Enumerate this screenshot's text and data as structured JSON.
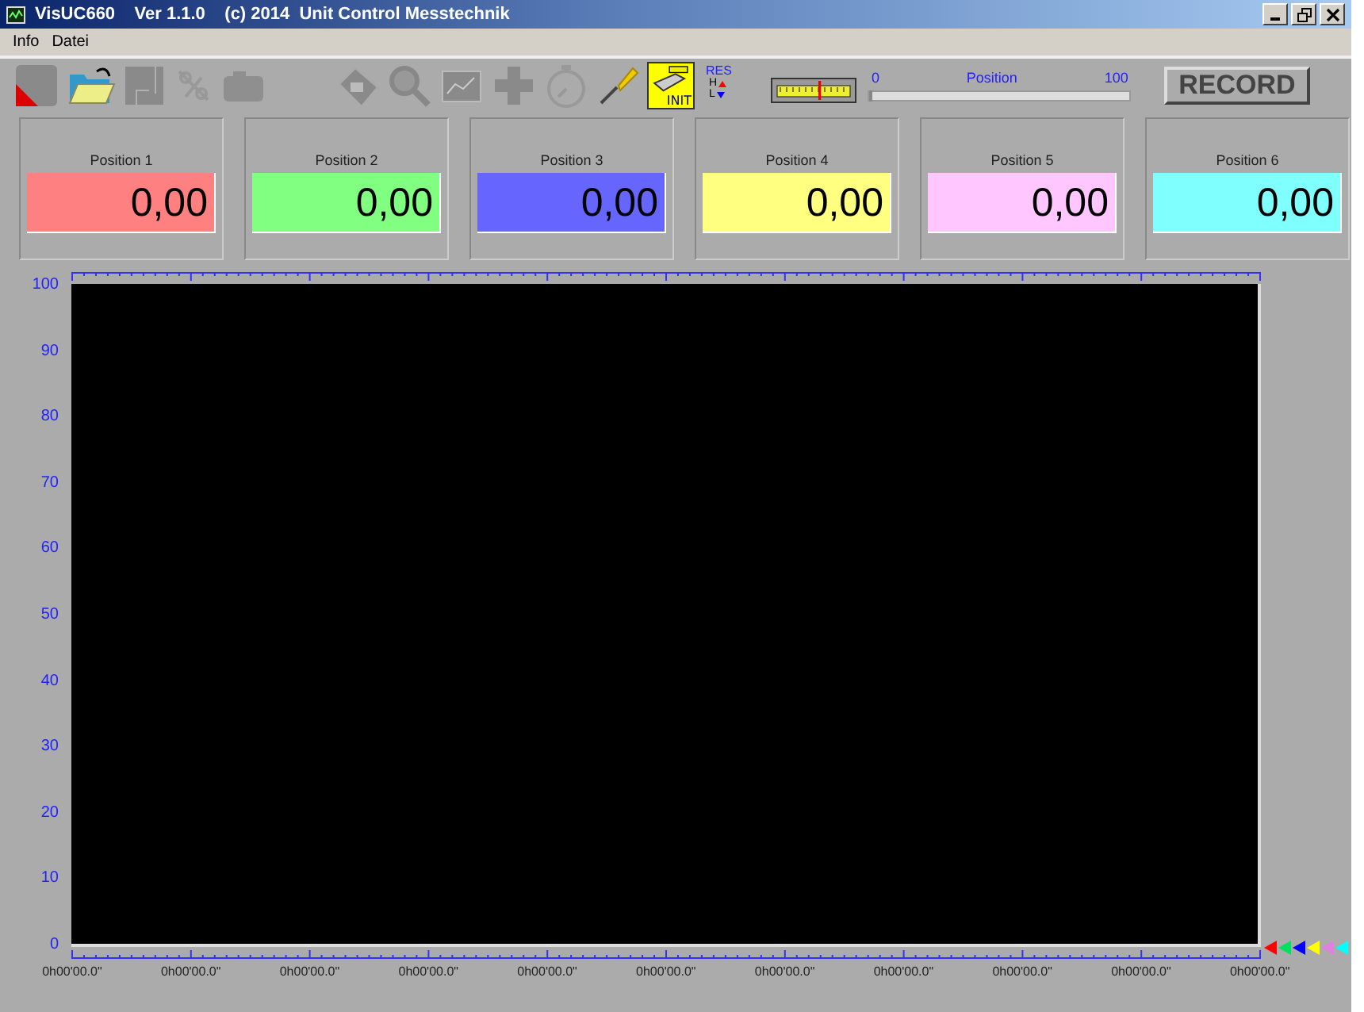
{
  "window": {
    "title": "VisUC660    Ver 1.1.0    (c) 2014  Unit Control Messtechnik"
  },
  "menu": [
    "Info",
    "Datei"
  ],
  "toolbar": {
    "init_label": "INIT",
    "res_label": "RES",
    "high_label": "H",
    "low_label": "L"
  },
  "position_slider": {
    "min_label": "0",
    "label": "Position",
    "max_label": "100",
    "level": 0
  },
  "record_button": "RECORD",
  "positions": [
    {
      "label": "Position 1",
      "value": "0,00",
      "color": "#ff8080"
    },
    {
      "label": "Position 2",
      "value": "0,00",
      "color": "#80ff80"
    },
    {
      "label": "Position 3",
      "value": "0,00",
      "color": "#6666ff"
    },
    {
      "label": "Position 4",
      "value": "0,00",
      "color": "#ffff80"
    },
    {
      "label": "Position 5",
      "value": "0,00",
      "color": "#ffc6ff"
    },
    {
      "label": "Position 6",
      "value": "0,00",
      "color": "#80ffff"
    }
  ],
  "plot": {
    "y_labels": [
      "100",
      "90",
      "80",
      "70",
      "60",
      "50",
      "40",
      "30",
      "20",
      "10",
      "0"
    ],
    "x_labels": [
      "0h00'00.0\"",
      "0h00'00.0\"",
      "0h00'00.0\"",
      "0h00'00.0\"",
      "0h00'00.0\"",
      "0h00'00.0\"",
      "0h00'00.0\"",
      "0h00'00.0\"",
      "0h00'00.0\"",
      "0h00'00.0\"",
      "0h00'00.0\""
    ],
    "channel_markers": [
      {
        "color": "#ff0000"
      },
      {
        "color": "#00e060"
      },
      {
        "color": "#0000ff"
      },
      {
        "color": "#ffff00"
      },
      {
        "color": "#e080e0"
      },
      {
        "color": "#00ffff"
      }
    ]
  }
}
